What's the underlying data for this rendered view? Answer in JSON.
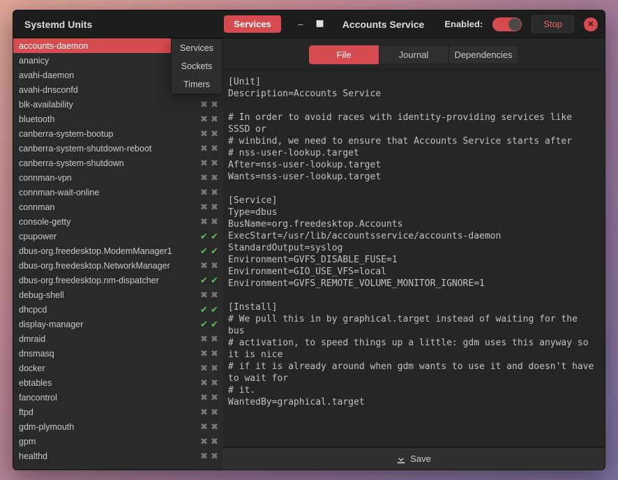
{
  "header": {
    "app_title": "Systemd Units",
    "services_button": "Services",
    "minimize": "–",
    "maximize": "⛶",
    "unit_title": "Accounts Service",
    "enabled_label": "Enabled:",
    "stop_label": "Stop",
    "close_glyph": "✕"
  },
  "dropdown": {
    "items": [
      "Services",
      "Sockets",
      "Timers"
    ]
  },
  "tabs": {
    "file": "File",
    "journal": "Journal",
    "dependencies": "Dependencies"
  },
  "save_label": "Save",
  "units": [
    {
      "name": "accounts-daemon",
      "a": true,
      "b": true,
      "selected": true
    },
    {
      "name": "ananicy",
      "a": false,
      "b": false
    },
    {
      "name": "avahi-daemon",
      "a": false,
      "b": false
    },
    {
      "name": "avahi-dnsconfd",
      "a": false,
      "b": false
    },
    {
      "name": "blk-availability",
      "a": false,
      "b": false
    },
    {
      "name": "bluetooth",
      "a": false,
      "b": false
    },
    {
      "name": "canberra-system-bootup",
      "a": false,
      "b": false
    },
    {
      "name": "canberra-system-shutdown-reboot",
      "a": false,
      "b": false
    },
    {
      "name": "canberra-system-shutdown",
      "a": false,
      "b": false
    },
    {
      "name": "connman-vpn",
      "a": false,
      "b": false
    },
    {
      "name": "connman-wait-online",
      "a": false,
      "b": false
    },
    {
      "name": "connman",
      "a": false,
      "b": false
    },
    {
      "name": "console-getty",
      "a": false,
      "b": false
    },
    {
      "name": "cpupower",
      "a": true,
      "b": true
    },
    {
      "name": "dbus-org.freedesktop.ModemManager1",
      "a": true,
      "b": true
    },
    {
      "name": "dbus-org.freedesktop.NetworkManager",
      "a": false,
      "b": false
    },
    {
      "name": "dbus-org.freedesktop.nm-dispatcher",
      "a": true,
      "b": true
    },
    {
      "name": "debug-shell",
      "a": false,
      "b": false
    },
    {
      "name": "dhcpcd",
      "a": true,
      "b": true
    },
    {
      "name": "display-manager",
      "a": true,
      "b": true
    },
    {
      "name": "dmraid",
      "a": false,
      "b": false
    },
    {
      "name": "dnsmasq",
      "a": false,
      "b": false
    },
    {
      "name": "docker",
      "a": false,
      "b": false
    },
    {
      "name": "ebtables",
      "a": false,
      "b": false
    },
    {
      "name": "fancontrol",
      "a": false,
      "b": false
    },
    {
      "name": "ftpd",
      "a": false,
      "b": false
    },
    {
      "name": "gdm-plymouth",
      "a": false,
      "b": false
    },
    {
      "name": "gpm",
      "a": false,
      "b": false
    },
    {
      "name": "healthd",
      "a": false,
      "b": false
    }
  ],
  "file_content": "[Unit]\nDescription=Accounts Service\n\n# In order to avoid races with identity-providing services like SSSD or\n# winbind, we need to ensure that Accounts Service starts after\n# nss-user-lookup.target\nAfter=nss-user-lookup.target\nWants=nss-user-lookup.target\n\n[Service]\nType=dbus\nBusName=org.freedesktop.Accounts\nExecStart=/usr/lib/accountsservice/accounts-daemon\nStandardOutput=syslog\nEnvironment=GVFS_DISABLE_FUSE=1\nEnvironment=GIO_USE_VFS=local\nEnvironment=GVFS_REMOTE_VOLUME_MONITOR_IGNORE=1\n\n[Install]\n# We pull this in by graphical.target instead of waiting for the bus\n# activation, to speed things up a little: gdm uses this anyway so it is nice\n# if it is already around when gdm wants to use it and doesn't have to wait for\n# it.\nWantedBy=graphical.target"
}
